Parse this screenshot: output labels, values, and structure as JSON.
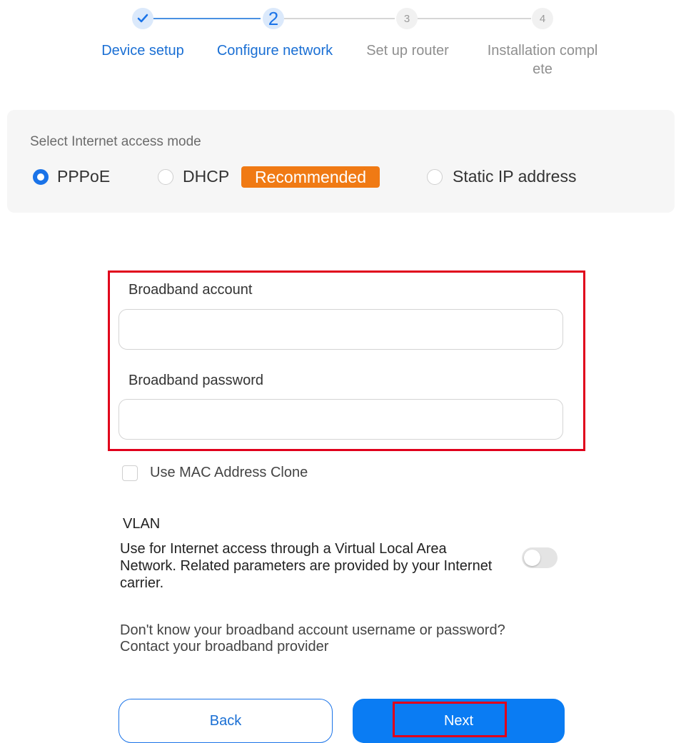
{
  "stepper": {
    "steps": [
      {
        "number": "✓",
        "label": "Device setup"
      },
      {
        "number": "2",
        "label": "Configure network"
      },
      {
        "number": "3",
        "label": "Set up router"
      },
      {
        "number": "4",
        "label_line1": "Installation compl",
        "label_line2": "ete"
      }
    ]
  },
  "access_mode": {
    "title": "Select Internet access mode",
    "options": [
      {
        "label": "PPPoE",
        "selected": true
      },
      {
        "label": "DHCP",
        "selected": false,
        "badge": "Recommended"
      },
      {
        "label": "Static IP address",
        "selected": false
      }
    ]
  },
  "credentials": {
    "account_label": "Broadband account",
    "account_value": "",
    "password_label": "Broadband password",
    "password_value": ""
  },
  "mac_clone": {
    "label": "Use MAC Address Clone",
    "checked": false
  },
  "vlan": {
    "title": "VLAN",
    "description": "Use for Internet access through a Virtual Local Area Network. Related parameters are provided by your Internet carrier.",
    "enabled": false
  },
  "help": {
    "line1": "Don't know your broadband account username or password?",
    "line2": "Contact your broadband provider"
  },
  "buttons": {
    "back": "Back",
    "next": "Next"
  },
  "colors": {
    "accent": "#1a73e8",
    "badge": "#f07a14",
    "highlight": "#e0001b"
  }
}
